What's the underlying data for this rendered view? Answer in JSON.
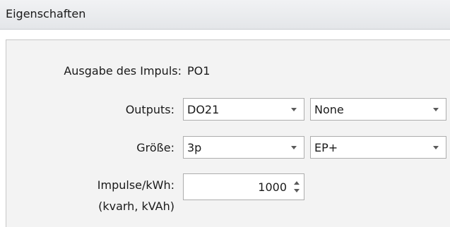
{
  "header": {
    "title": "Eigenschaften"
  },
  "form": {
    "ausgabe": {
      "label": "Ausgabe des Impuls:",
      "value": "PO1"
    },
    "outputs": {
      "label": "Outputs:",
      "select1": "DO21",
      "select2": "None"
    },
    "groesse": {
      "label": "Größe:",
      "select1": "3p",
      "select2": "EP+"
    },
    "impulse": {
      "label": "Impulse/kWh:",
      "sublabel": "(kvarh, kVAh)",
      "value": "1000"
    }
  },
  "icons": {
    "dropdown": "chevron-down-icon",
    "spin_up": "spin-up-icon",
    "spin_down": "spin-down-icon"
  },
  "colors": {
    "header_bg": "#e8e9ec",
    "panel_bg": "#f3f3f3",
    "field_border": "#adadad"
  }
}
